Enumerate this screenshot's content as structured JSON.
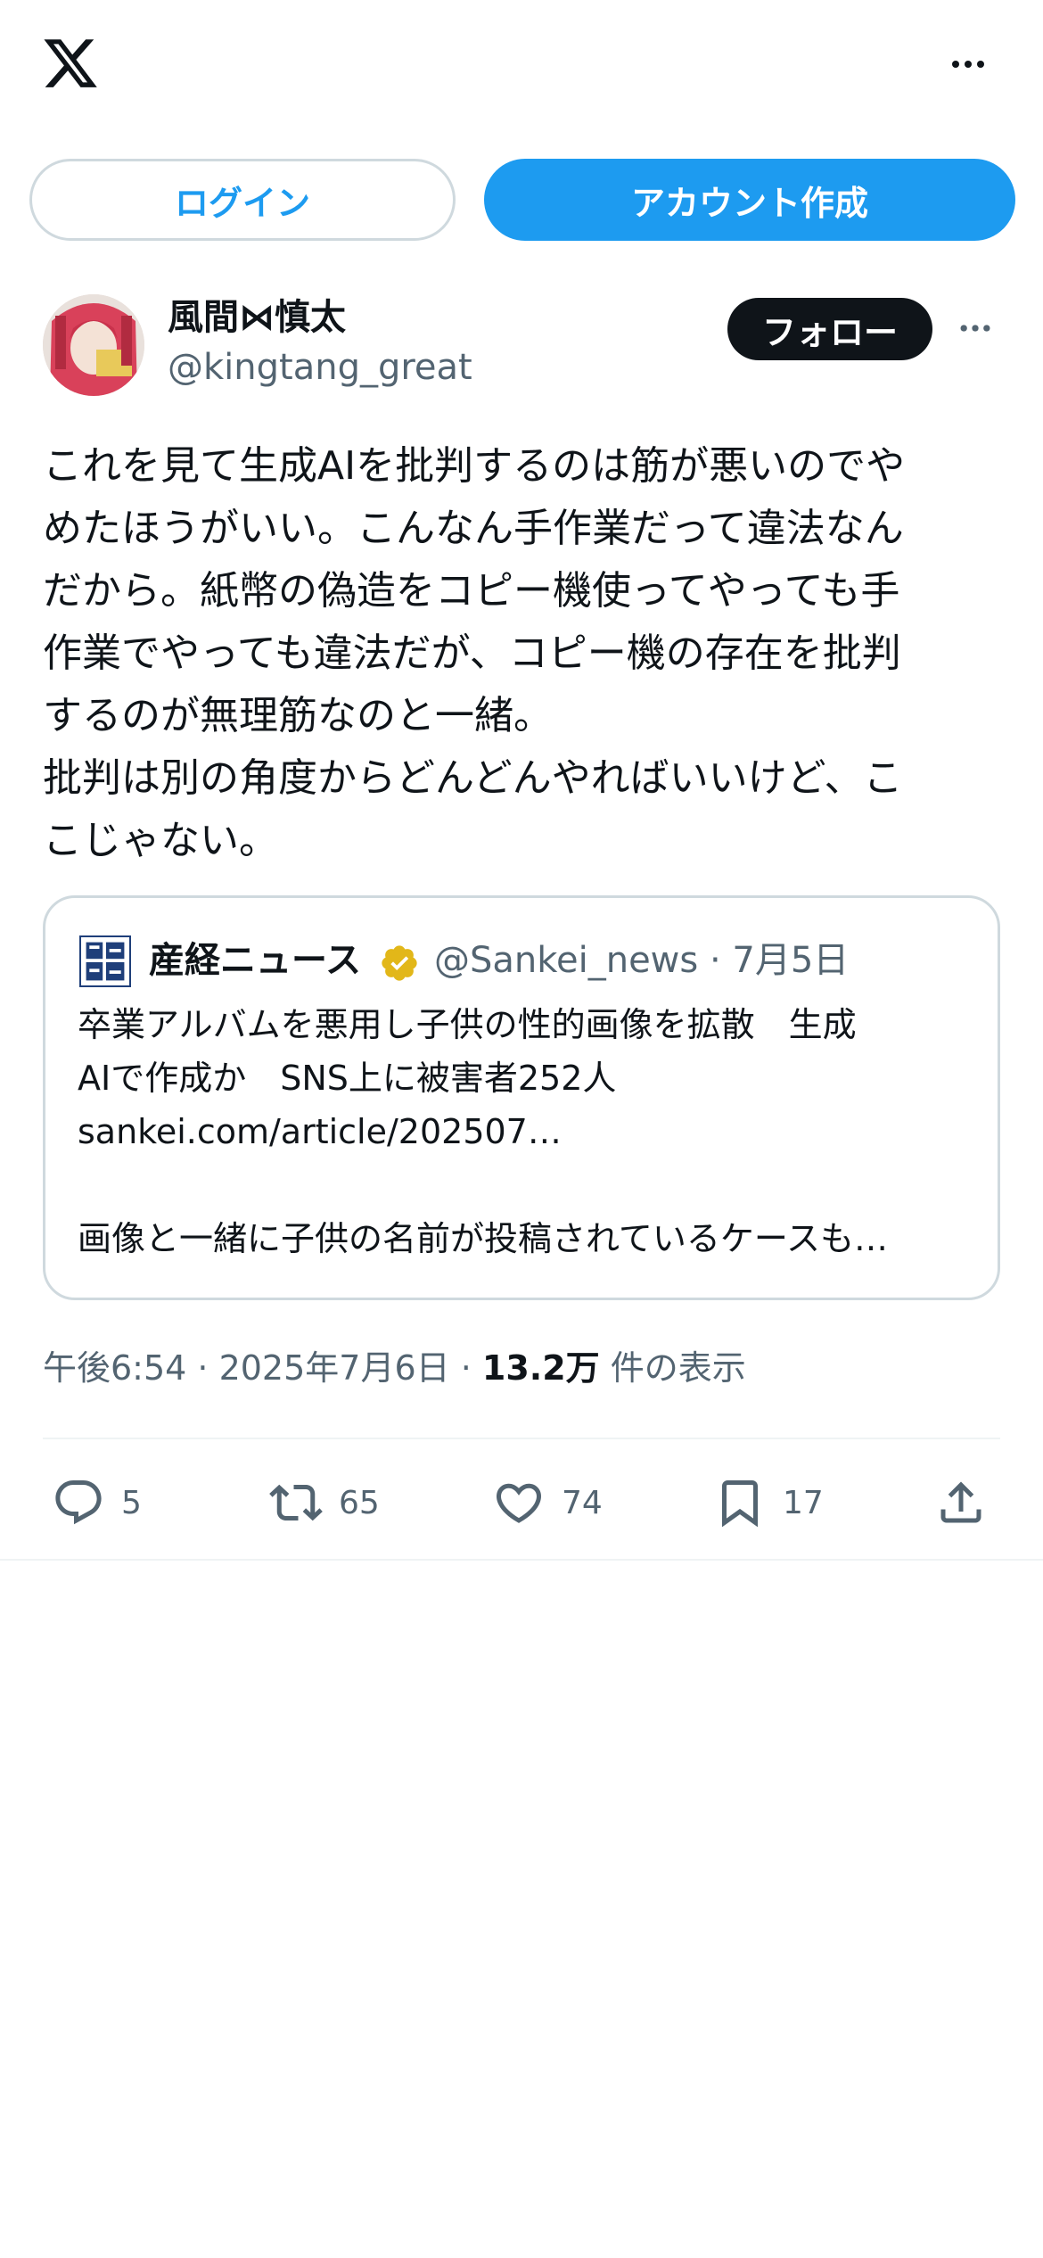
{
  "header": {
    "logo_icon": "x-logo-icon",
    "more_icon": "more-horizontal-icon"
  },
  "auth": {
    "login_label": "ログイン",
    "signup_label": "アカウント作成"
  },
  "tweet": {
    "author": {
      "display_name": "風間⋈慎太",
      "handle": "@kingtang_great"
    },
    "follow_label": "フォロー",
    "text": "これを見て生成AIを批判するのは筋が悪いのでや\nめたほうがいい。こんなん手作業だって違法なん\nだから。紙幣の偽造をコピー機使ってやっても手\n作業でやっても違法だが、コピー機の存在を批判\nするのが無理筋なのと一緒。\n批判は別の角度からどんどんやればいいけど、こ\nこじゃない。",
    "quote": {
      "name": "産経ニュース",
      "meta": "@Sankei_news · 7月5日",
      "text": "卒業アルバムを悪用し子供の性的画像を拡散　生成\nAIで作成か　SNS上に被害者252人\nsankei.com/article/202507…\n\n画像と一緒に子供の名前が投稿されているケースも…"
    },
    "time": "午後6:54 · 2025年7月6日 · ",
    "views": "13.2万",
    "views_label": " 件の表示",
    "actions": {
      "replies": "5",
      "retweets": "65",
      "likes": "74",
      "bookmarks": "17"
    }
  },
  "colors": {
    "accent": "#1d9bf0",
    "text": "#0f1419",
    "secondary": "#536471",
    "border": "#cfd9de",
    "verified": "#e2b719"
  }
}
